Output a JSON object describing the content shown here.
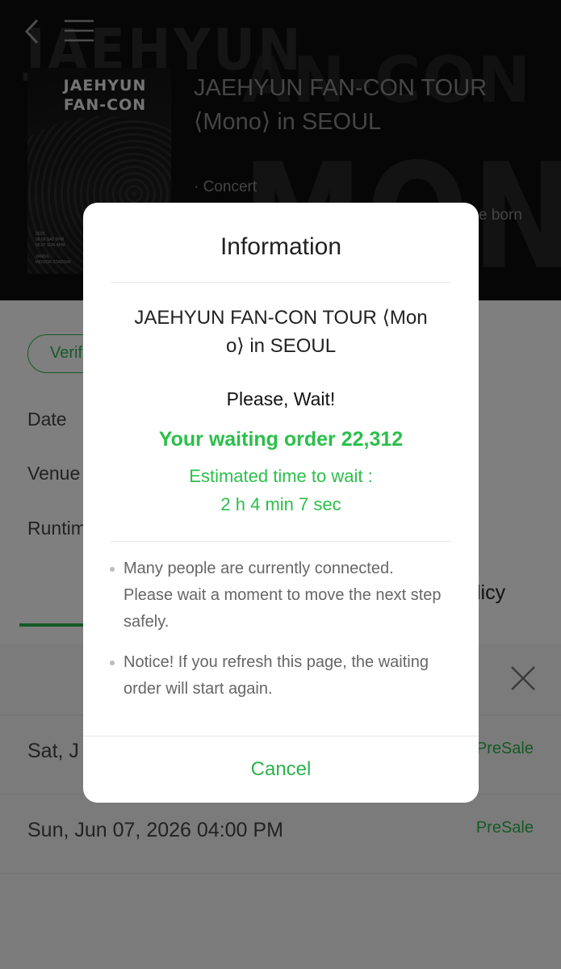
{
  "hero": {
    "title": "JAEHYUN FAN-CON TOUR ⟨Mono⟩ in SEOUL",
    "category": "· Concert",
    "extra_text": "e born",
    "poster": {
      "artist_line1": "JAEHYUN",
      "artist_line2": "FAN-CON",
      "details": "2026\n06.06 SAT 6PM\n06.07 SUN 4PM\n\nJAMSIL\nINDOOR STADIUM"
    },
    "bg_word_large": "MONO",
    "bg_word_small": "AN-CON",
    "bg_name": "JAEHYUN"
  },
  "info": {
    "verify_button": "Verif",
    "rows": {
      "date": "Date",
      "venue": "Venue",
      "runtime": "Runtim"
    },
    "policy_tab": "licy"
  },
  "sheet": {
    "dates": [
      {
        "date": "Sat, J",
        "status": "PreSale"
      },
      {
        "date": "Sun, Jun 07, 2026 04:00 PM",
        "status": "PreSale"
      }
    ]
  },
  "modal": {
    "title": "Information",
    "event_line1": "JAEHYUN FAN-CON TOUR ⟨Mon",
    "event_line2": "o⟩ in SEOUL",
    "wait_text": "Please, Wait!",
    "waiting_order": "Your waiting order 22,312",
    "estimated_label": "Estimated time to wait :",
    "estimated_value": "2 h 4 min 7 sec",
    "notes": [
      "Many people are currently connected. Please wait a moment to move the next step safely.",
      "Notice! If you refresh this page, the waiting order will start again."
    ],
    "cancel_label": "Cancel"
  },
  "colors": {
    "accent_green": "#2bb24c",
    "overlay": "rgba(0,0,0,0.5)"
  },
  "icons": [
    "back-arrow-icon",
    "menu-icon",
    "close-icon",
    "bullet-icon"
  ]
}
